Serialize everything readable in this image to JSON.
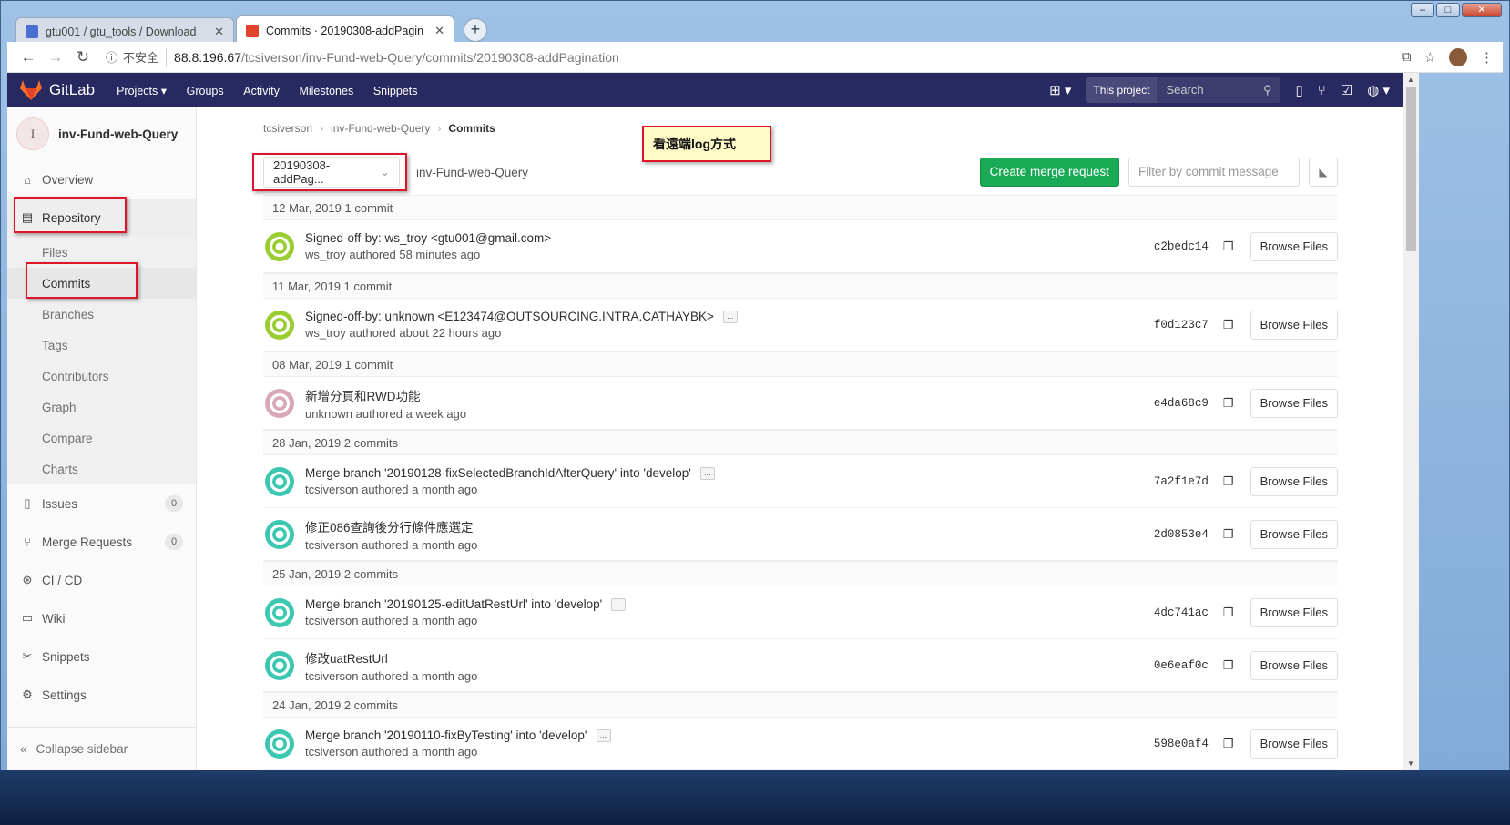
{
  "browser": {
    "tabs": [
      {
        "label": "gtu001 / gtu_tools / Download",
        "icon_color": "#4a6fd4"
      },
      {
        "label": "Commits · 20190308-addPagin",
        "icon_color": "#e2432a"
      }
    ],
    "insecure_label": "不安全",
    "url_host": "88.8.196.67",
    "url_path": "/tcsiverson/inv-Fund-web-Query/commits/20190308-addPagination"
  },
  "header": {
    "brand": "GitLab",
    "nav": [
      "Projects",
      "Groups",
      "Activity",
      "Milestones",
      "Snippets"
    ],
    "scope": "This project",
    "search_placeholder": "Search"
  },
  "sidebar": {
    "project_initial": "I",
    "project_name": "inv-Fund-web-Query",
    "overview": "Overview",
    "repository": "Repository",
    "repo_items": [
      "Files",
      "Commits",
      "Branches",
      "Tags",
      "Contributors",
      "Graph",
      "Compare",
      "Charts"
    ],
    "issues": "Issues",
    "issues_count": "0",
    "merge_requests": "Merge Requests",
    "mr_count": "0",
    "cicd": "CI / CD",
    "wiki": "Wiki",
    "snippets": "Snippets",
    "settings": "Settings",
    "collapse": "Collapse sidebar"
  },
  "breadcrumb": [
    "tcsiverson",
    "inv-Fund-web-Query",
    "Commits"
  ],
  "annotation_note": "看遠端log方式",
  "toolbar": {
    "branch": "20190308-addPag...",
    "repo": "inv-Fund-web-Query",
    "create_mr": "Create merge request",
    "filter_placeholder": "Filter by commit message"
  },
  "browse_label": "Browse Files",
  "groups": [
    {
      "date": "12 Mar, 2019 1 commit",
      "commits": [
        {
          "title": "Signed-off-by: ws_troy <gtu001@gmail.com>",
          "meta": "ws_troy authored 58 minutes ago",
          "sha": "c2bedc14",
          "more": false,
          "avatar": "#9acd32"
        }
      ]
    },
    {
      "date": "11 Mar, 2019 1 commit",
      "commits": [
        {
          "title": "Signed-off-by: unknown <E123474@OUTSOURCING.INTRA.CATHAYBK>",
          "meta": "ws_troy authored about 22 hours ago",
          "sha": "f0d123c7",
          "more": true,
          "avatar": "#9acd32"
        }
      ]
    },
    {
      "date": "08 Mar, 2019 1 commit",
      "commits": [
        {
          "title": "新增分頁和RWD功能",
          "meta": "unknown authored a week ago",
          "sha": "e4da68c9",
          "more": false,
          "avatar": "#d8a7b8"
        }
      ]
    },
    {
      "date": "28 Jan, 2019 2 commits",
      "commits": [
        {
          "title": "Merge branch '20190128-fixSelectedBranchIdAfterQuery' into 'develop'",
          "meta": "tcsiverson authored a month ago",
          "sha": "7a2f1e7d",
          "more": true,
          "avatar": "#3cc8b0"
        },
        {
          "title": "修正086查詢後分行條件應選定",
          "meta": "tcsiverson authored a month ago",
          "sha": "2d0853e4",
          "more": false,
          "avatar": "#3cc8b0"
        }
      ]
    },
    {
      "date": "25 Jan, 2019 2 commits",
      "commits": [
        {
          "title": "Merge branch '20190125-editUatRestUrl' into 'develop'",
          "meta": "tcsiverson authored a month ago",
          "sha": "4dc741ac",
          "more": true,
          "avatar": "#3cc8b0"
        },
        {
          "title": "修改uatRestUrl",
          "meta": "tcsiverson authored a month ago",
          "sha": "0e6eaf0c",
          "more": false,
          "avatar": "#3cc8b0"
        }
      ]
    },
    {
      "date": "24 Jan, 2019 2 commits",
      "commits": [
        {
          "title": "Merge branch '20190110-fixByTesting' into 'develop'",
          "meta": "tcsiverson authored a month ago",
          "sha": "598e0af4",
          "more": true,
          "avatar": "#3cc8b0"
        }
      ]
    }
  ]
}
